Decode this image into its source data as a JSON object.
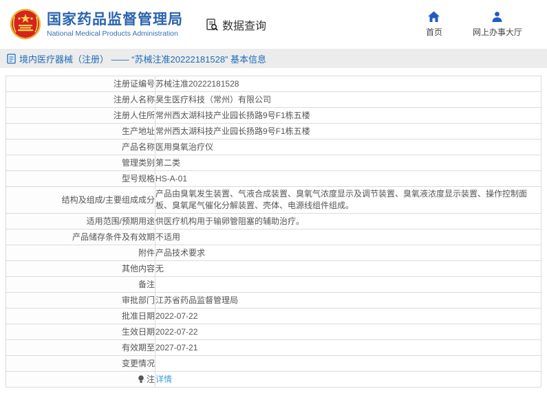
{
  "header": {
    "title": "国家药品监督管理局",
    "subtitle": "National Medical Products Administration",
    "section": "数据查询",
    "nav": [
      {
        "icon": "home-icon",
        "label": "首页"
      },
      {
        "icon": "user-icon",
        "label": "网上办事大厅"
      }
    ]
  },
  "breadcrumb": {
    "text": "境内医疗器械（注册） ——  “苏械注准20222181528”  基本信息"
  },
  "table": {
    "rows": [
      {
        "label": "注册证编号",
        "value": "苏械注准20222181528"
      },
      {
        "label": "注册人名称",
        "value": "昊生医疗科技（常州）有限公司"
      },
      {
        "label": "注册人住所",
        "value": "常州西太湖科技产业园长扬路9号F1栋五楼"
      },
      {
        "label": "生产地址",
        "value": "常州西太湖科技产业园长扬路9号F1栋五楼"
      },
      {
        "label": "产品名称",
        "value": "医用臭氧治疗仪"
      },
      {
        "label": "管理类别",
        "value": "第二类"
      },
      {
        "label": "型号规格",
        "value": "HS-A-01"
      },
      {
        "label": "结构及组成/主要组成成分",
        "value": "产品由臭氧发生装置、气液合成装置、臭氧气浓度显示及调节装置、臭氧液浓度显示装置、操作控制面板、臭氧尾气催化分解装置、壳体、电源线组件组成。"
      },
      {
        "label": "适用范围/预期用途",
        "value": "供医疗机构用于输卵管阻塞的辅助治疗。"
      },
      {
        "label": "产品储存条件及有效期",
        "value": "不适用"
      },
      {
        "label": "附件",
        "value": "产品技术要求"
      },
      {
        "label": "其他内容",
        "value": "无"
      },
      {
        "label": "备注",
        "value": ""
      },
      {
        "label": "审批部门",
        "value": "江苏省药品监督管理局"
      },
      {
        "label": "批准日期",
        "value": "2022-07-22"
      },
      {
        "label": "生效日期",
        "value": "2022-07-22"
      },
      {
        "label": "有效期至",
        "value": "2027-07-21"
      },
      {
        "label": "变更情况",
        "value": ""
      },
      {
        "label": "注",
        "label_icon": "lightbulb-icon",
        "value": "详情",
        "value_is_link": true
      }
    ]
  },
  "colors": {
    "title_blue": "#2a64ad",
    "nav_icon_blue": "#2359c4",
    "breadcrumb_blue": "#1e6bb8",
    "link_blue": "#3f9fd8",
    "emblem_red": "#d6231f",
    "emblem_gold": "#f7d64a",
    "bar_gray": "#ececec",
    "border_gray": "#dbdbdb"
  }
}
